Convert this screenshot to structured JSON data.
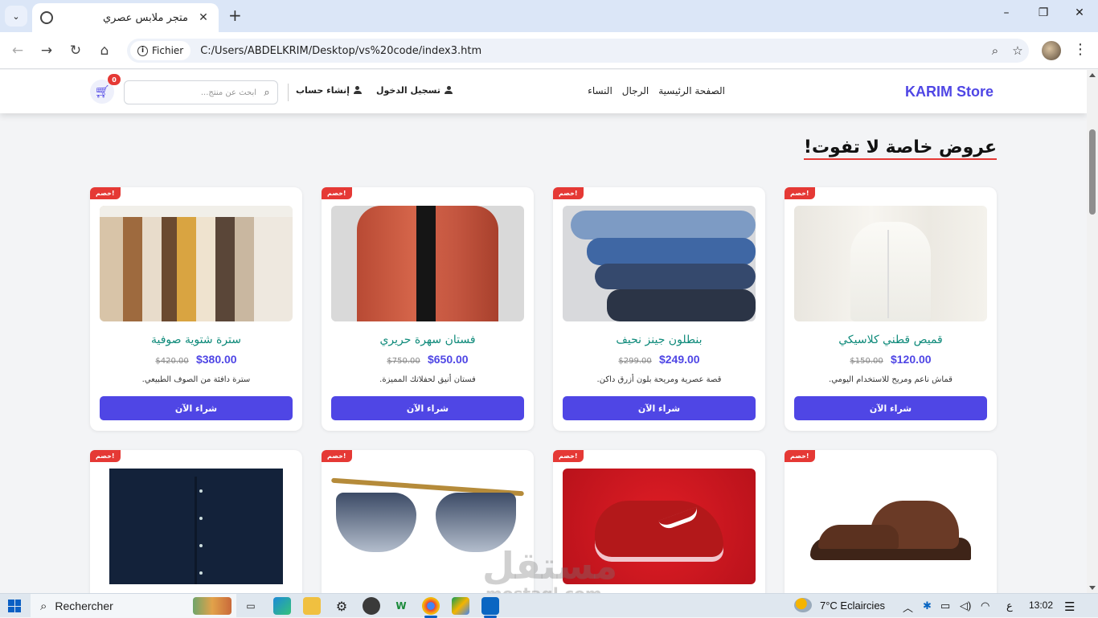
{
  "browser": {
    "tab_title": "متجر ملابس عصري",
    "url_chip": "Fichier",
    "url": "C:/Users/ABDELKRIM/Desktop/vs%20code/index3.htm",
    "new_tab": "+",
    "minimize": "–",
    "restore": "❐",
    "close": "✕"
  },
  "site": {
    "brand": "KARIM Store",
    "nav": [
      "الصفحة الرئيسية",
      "الرجال",
      "النساء"
    ],
    "login": "تسجيل الدخول",
    "signup": "إنشاء حساب",
    "search_placeholder": "ابحث عن منتج...",
    "cart_count": "0",
    "section_title": "عروض خاصة لا تفوت!",
    "badge_text": "خصم!",
    "buy_label": "شراء الآن"
  },
  "products_row1": [
    {
      "name": "قميص قطني كلاسيكي",
      "old_price": "$150.00",
      "new_price": "$120.00",
      "desc": "قماش ناعم ومريح للاستخدام اليومي."
    },
    {
      "name": "بنطلون جينز نحيف",
      "old_price": "$299.00",
      "new_price": "$249.00",
      "desc": "قصة عصرية ومريحة بلون أزرق داكن."
    },
    {
      "name": "فستان سهرة حريري",
      "old_price": "$750.00",
      "new_price": "$650.00",
      "desc": "فستان أنيق لحفلاتك المميزة."
    },
    {
      "name": "سترة شتوية صوفية",
      "old_price": "$420.00",
      "new_price": "$380.00",
      "desc": "سترة دافئة من الصوف الطبيعي."
    }
  ],
  "watermark": {
    "arabic": "مستقل",
    "latin": "mostaql.com"
  },
  "taskbar": {
    "search_label": "Rechercher",
    "weather": "7°C  Eclaircies",
    "lang": "ع",
    "time": "13:02"
  },
  "colors": {
    "accent": "#4f46e5",
    "badge": "#e53935",
    "product_name": "#0e8a7a"
  }
}
